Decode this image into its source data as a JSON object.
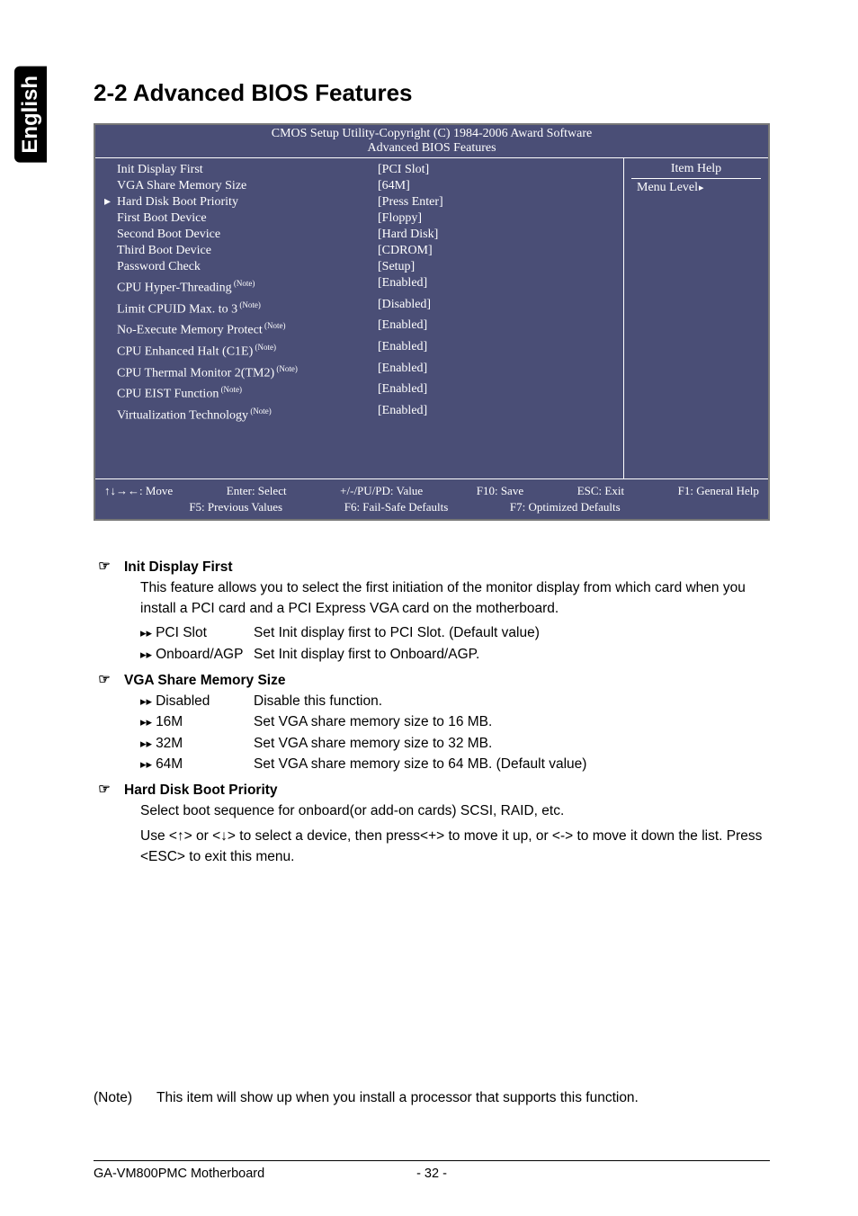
{
  "side_tab": "English",
  "section_title": "2-2   Advanced BIOS Features",
  "bios": {
    "header": "CMOS Setup Utility-Copyright (C) 1984-2006 Award Software",
    "subheader": "Advanced BIOS Features",
    "rows": [
      {
        "label": "Init Display First",
        "value": "[PCI Slot]",
        "note": false,
        "pointer": false
      },
      {
        "label": "VGA Share Memory Size",
        "value": "[64M]",
        "note": false,
        "pointer": false
      },
      {
        "label": "Hard Disk Boot Priority",
        "value": "[Press Enter]",
        "note": false,
        "pointer": true
      },
      {
        "label": "First Boot Device",
        "value": "[Floppy]",
        "note": false,
        "pointer": false
      },
      {
        "label": "Second Boot Device",
        "value": "[Hard Disk]",
        "note": false,
        "pointer": false
      },
      {
        "label": "Third Boot Device",
        "value": "[CDROM]",
        "note": false,
        "pointer": false
      },
      {
        "label": "Password Check",
        "value": "[Setup]",
        "note": false,
        "pointer": false
      },
      {
        "label": "CPU Hyper-Threading",
        "value": "[Enabled]",
        "note": true,
        "pointer": false
      },
      {
        "label": "Limit CPUID Max. to 3",
        "value": "[Disabled]",
        "note": true,
        "pointer": false
      },
      {
        "label": "No-Execute Memory Protect",
        "value": "[Enabled]",
        "note": true,
        "pointer": false
      },
      {
        "label": "CPU Enhanced Halt (C1E)",
        "value": "[Enabled]",
        "note": true,
        "pointer": false
      },
      {
        "label": "CPU Thermal Monitor 2(TM2)",
        "value": "[Enabled]",
        "note": true,
        "pointer": false
      },
      {
        "label": "CPU EIST Function",
        "value": "[Enabled]",
        "note": true,
        "pointer": false
      },
      {
        "label": "Virtualization Technology",
        "value": "[Enabled]",
        "note": true,
        "pointer": false
      }
    ],
    "note_label": "(Note)",
    "right": {
      "item_help": "Item Help",
      "menu_level": "Menu Level"
    },
    "footer": {
      "row1": {
        "a": "↑↓→←: Move",
        "b": "Enter: Select",
        "c": "+/-/PU/PD: Value",
        "d": "F10: Save",
        "e": "ESC: Exit",
        "f": "F1: General Help"
      },
      "row2": {
        "a": "F5: Previous Values",
        "b": "F6: Fail-Safe Defaults",
        "c": "F7: Optimized Defaults"
      }
    }
  },
  "options": {
    "hand": "☞",
    "arrow": "▸▸",
    "sec1": {
      "title": "Init Display First",
      "para": "This feature allows you to select the first initiation of the monitor display from which card when you install a PCI card and a PCI Express VGA card on the motherboard.",
      "rows": [
        {
          "k": "PCI Slot",
          "v": "Set Init display first to PCI Slot. (Default value)"
        },
        {
          "k": "Onboard/AGP",
          "v": "Set Init display first to Onboard/AGP."
        }
      ]
    },
    "sec2": {
      "title": "VGA Share Memory Size",
      "rows": [
        {
          "k": "Disabled",
          "v": "Disable this function."
        },
        {
          "k": "16M",
          "v": "Set VGA share memory size to 16 MB."
        },
        {
          "k": "32M",
          "v": "Set VGA share memory size to 32 MB."
        },
        {
          "k": "64M",
          "v": "Set VGA share memory size to 64 MB. (Default value)"
        }
      ]
    },
    "sec3": {
      "title": "Hard Disk Boot Priority",
      "para1": "Select boot sequence for onboard(or add-on cards) SCSI, RAID, etc.",
      "para2": "Use <↑> or <↓> to select a device, then press<+> to move it up, or <-> to move it down the list. Press <ESC> to exit this menu."
    }
  },
  "note": {
    "label": "(Note)",
    "text": "This item will show up when you install a processor that supports this function."
  },
  "footer": {
    "left": "GA-VM800PMC Motherboard",
    "mid": "- 32 -"
  }
}
